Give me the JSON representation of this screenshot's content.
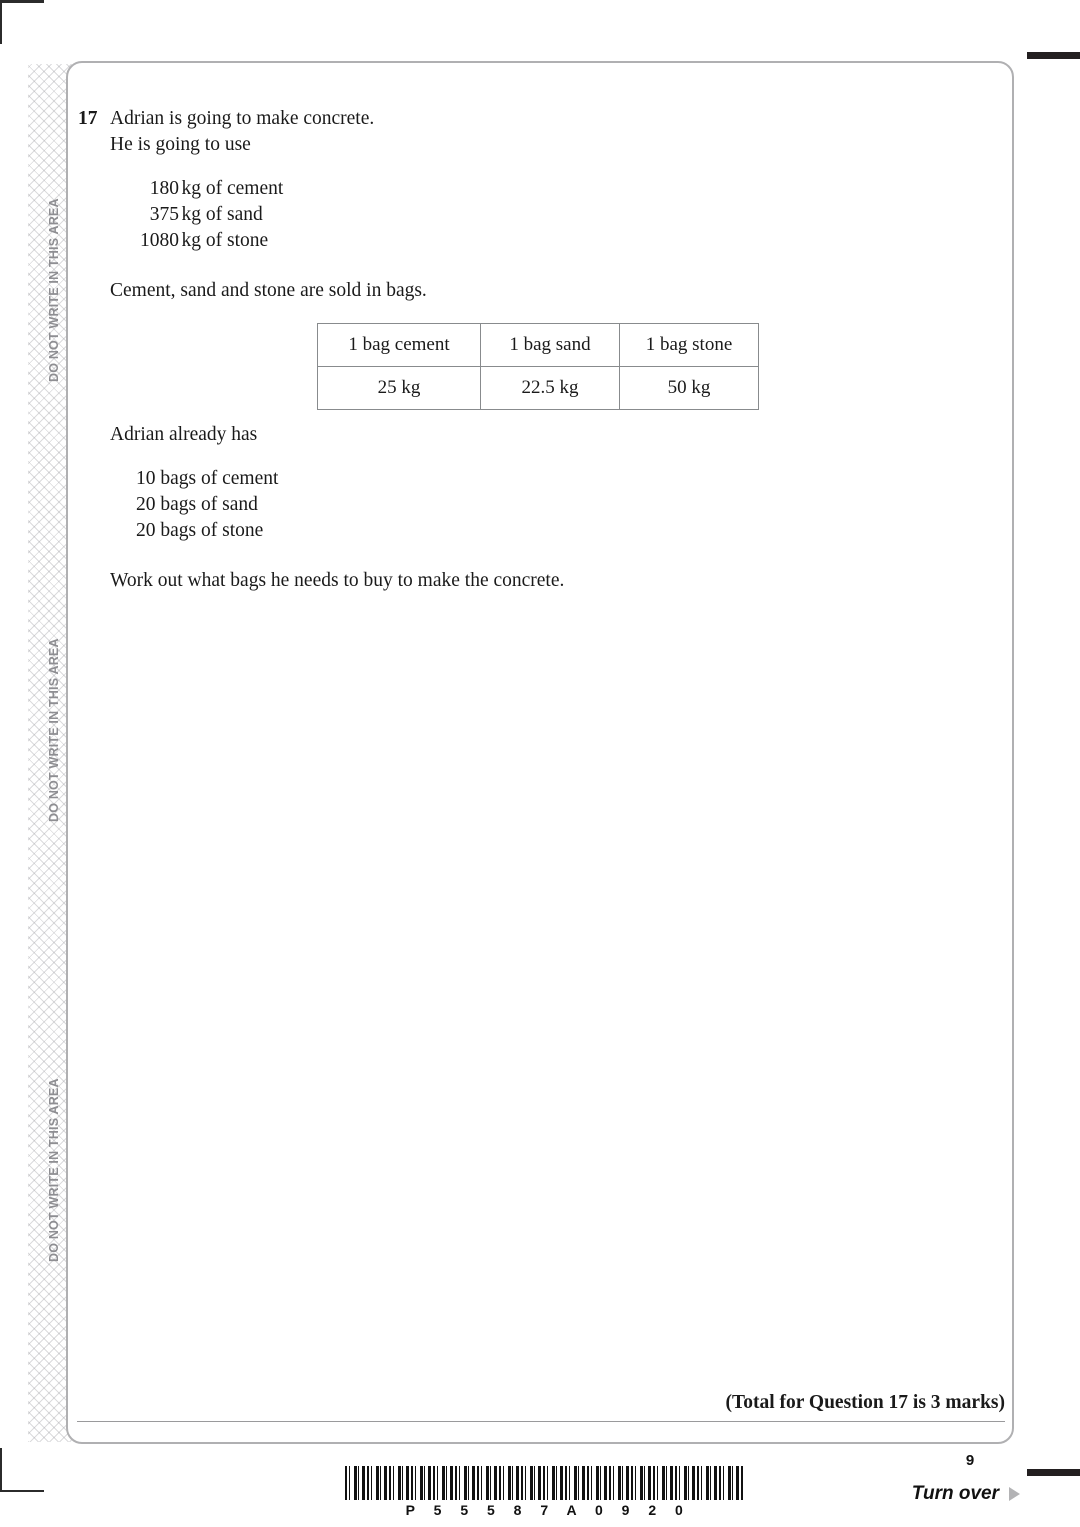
{
  "margin_notes": {
    "label": "DO NOT WRITE IN THIS AREA",
    "repeats": 3,
    "color": "#8e8e92"
  },
  "question": {
    "number": "17",
    "intro_lines": [
      "Adrian is going to make concrete.",
      "He is going to use"
    ],
    "quantities": [
      {
        "amount": "180",
        "unit": "kg of cement"
      },
      {
        "amount": "375",
        "unit": "kg of sand"
      },
      {
        "amount": "1080",
        "unit": "kg of stone"
      }
    ],
    "sold_in_bags_line": "Cement, sand and stone are sold in bags.",
    "already_has_line": "Adrian already has",
    "owned_bags": [
      "10 bags of cement",
      "20 bags of sand",
      "20 bags of stone"
    ],
    "instruction": "Work out what bags he needs to buy to make the concrete.",
    "marks_line": "(Total for Question 17 is 3 marks)"
  },
  "bag_table": {
    "headers": [
      "1 bag cement",
      "1 bag sand",
      "1 bag stone"
    ],
    "values": [
      "25 kg",
      "22.5 kg",
      "50 kg"
    ]
  },
  "footer": {
    "barcode_text": "P 5 5 5 8 7 A 0 9 2 0",
    "page_number": "9",
    "turn_over_label": "Turn over"
  }
}
